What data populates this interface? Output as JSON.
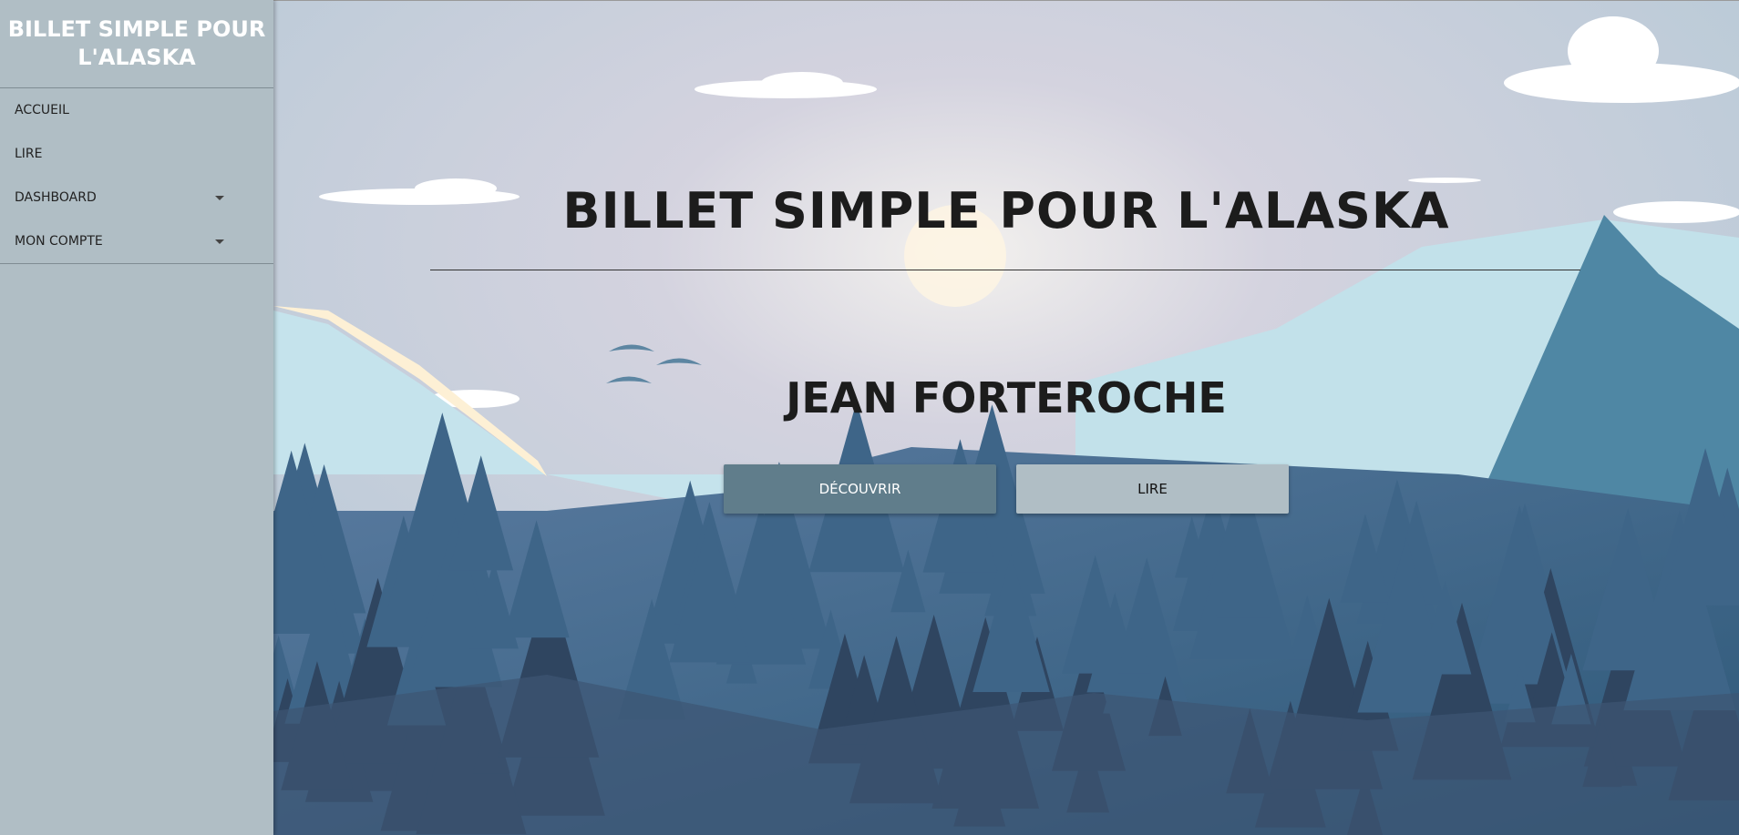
{
  "sidebar": {
    "brand": "BILLET SIMPLE POUR L'ALASKA",
    "items": [
      {
        "label": "ACCUEIL"
      },
      {
        "label": "LIRE"
      },
      {
        "label": "DASHBOARD",
        "dropdown": true
      },
      {
        "label": "MON COMPTE",
        "dropdown": true
      }
    ]
  },
  "hero": {
    "title": "BILLET SIMPLE POUR L'ALASKA",
    "author": "JEAN FORTEROCHE",
    "buttons": {
      "discover": "DÉCOUVRIR",
      "read": "LIRE"
    }
  },
  "colors": {
    "sidebar": "#b0bec5",
    "primary": "#607d8b"
  }
}
